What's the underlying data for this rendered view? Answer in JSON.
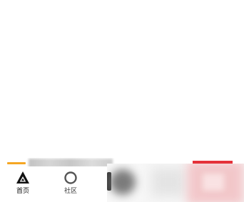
{
  "tabbar": {
    "tabs": [
      {
        "label": "首页",
        "icon": "triangle-logo-icon",
        "active": true
      },
      {
        "label": "社区",
        "icon": "circle-icon",
        "active": false
      }
    ]
  },
  "colors": {
    "accent_line": "#f5a623",
    "red_block": "#e5323a",
    "icon_dark": "#111111",
    "icon_gray": "#555555"
  }
}
